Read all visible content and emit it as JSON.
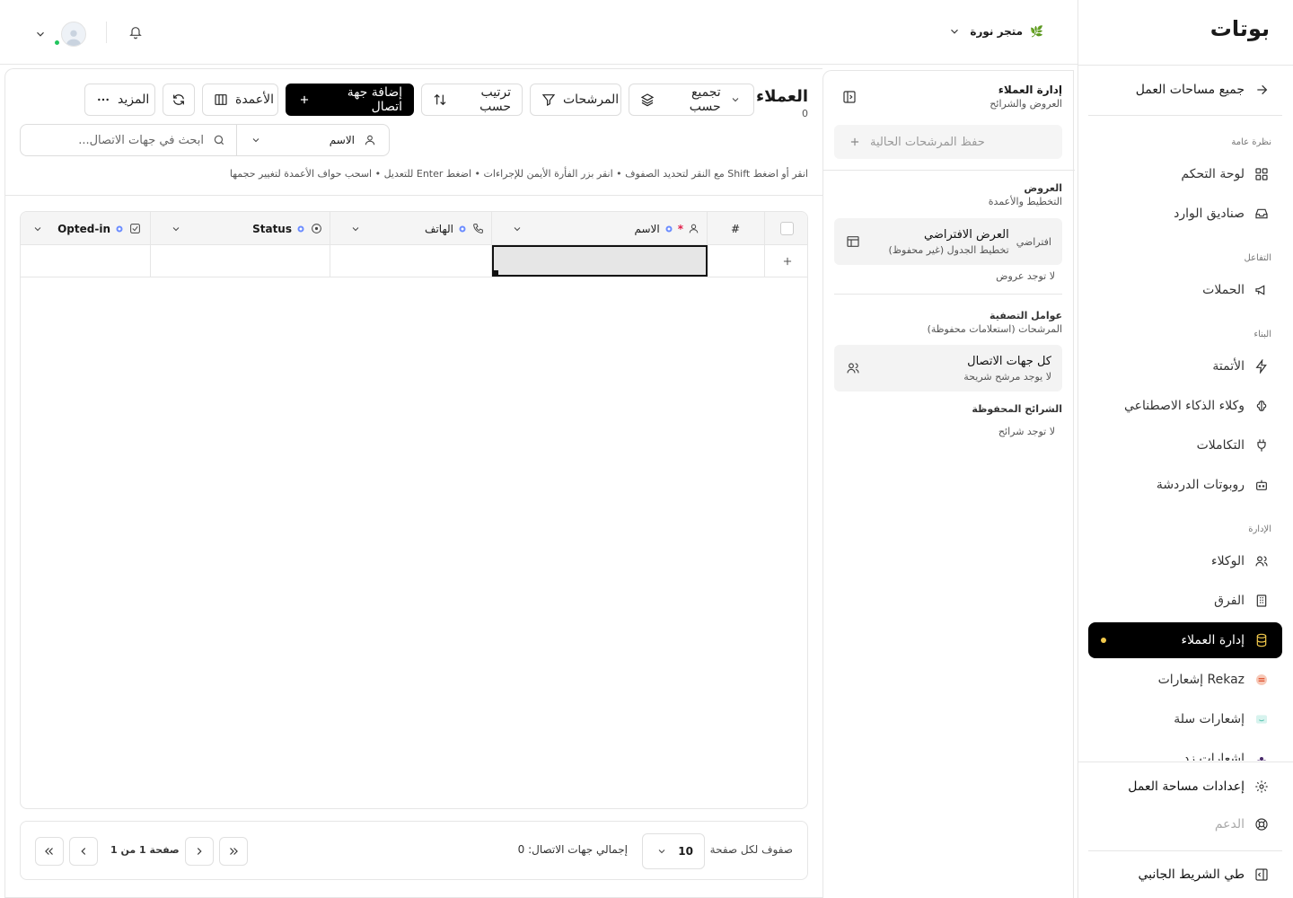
{
  "app": {
    "logo": "بوتات"
  },
  "topbar": {
    "store_name": "متجر نورة",
    "store_emoji": "🌿"
  },
  "sidebar": {
    "back_label": "جميع مساحات العمل",
    "groups": {
      "overview": "نظرة عامة",
      "interaction": "التفاعل",
      "build": "البناء",
      "management": "الإدارة"
    },
    "items": {
      "dashboard": "لوحة التحكم",
      "inboxes": "صناديق الوارد",
      "campaigns": "الحملات",
      "automation": "الأتمتة",
      "ai_agents": "وكلاء الذكاء الاصطناعي",
      "integrations": "التكاملات",
      "chatbots": "روبوتات الدردشة",
      "agents": "الوكلاء",
      "teams": "الفرق",
      "customers": "إدارة العملاء",
      "rekaz": "إشعارات Rekaz",
      "salla": "إشعارات سلة",
      "zid": "إشعارات زد"
    },
    "settings": "إعدادات مساحة العمل",
    "support": "الدعم",
    "collapse": "طي الشريط الجانبي"
  },
  "views_panel": {
    "title": "إدارة العملاء",
    "subtitle": "العروض والشرائح",
    "save_filters": "حفظ المرشحات الحالية",
    "views_title": "العروض",
    "views_subtitle": "التخطيط والأعمدة",
    "default_view_title": "العرض الافتراضي",
    "default_view_sub": "تخطيط الجدول (غير محفوظ)",
    "default_tag": "افتراضي",
    "no_views": "لا توجد عروض",
    "filters_title": "عوامل التصفية",
    "filters_subtitle": "المرشحات (استعلامات محفوظة)",
    "all_contacts_title": "كل جهات الاتصال",
    "all_contacts_sub": "لا يوجد مرشح شريحة",
    "segments_title": "الشرائح المحفوظة",
    "no_segments": "لا توجد شرائح"
  },
  "main": {
    "title": "العملاء",
    "count": "0",
    "toolbar": {
      "group_by": "تجميع حسب",
      "filters": "المرشحات",
      "sort_by": "ترتيب حسب",
      "add_contact": "إضافة جهة اتصال",
      "columns": "الأعمدة",
      "more": "المزيد"
    },
    "search": {
      "field": "الاسم",
      "placeholder": "ابحث في جهات الاتصال..."
    },
    "hint": "انقر أو اضغط Shift مع النقر لتحديد الصفوف • انقر بزر الفأرة الأيمن للإجراءات • اضغط Enter للتعديل • اسحب حواف الأعمدة لتغيير حجمها",
    "table": {
      "columns": {
        "index": "#",
        "name": "الاسم",
        "phone": "الهاتف",
        "status": "Status",
        "opted_in": "Opted-in"
      }
    },
    "pager": {
      "rows_per_page": "صفوف لكل صفحة",
      "page_size": "10",
      "total": "إجمالي جهات الاتصال: 0",
      "page_info": "صفحة 1 من 1"
    }
  },
  "colors": {
    "accent": "#f2c94c",
    "primary": "#000000",
    "status_online": "#22c55e",
    "required": "#e11d48",
    "field_icon": "#6b8cff"
  }
}
